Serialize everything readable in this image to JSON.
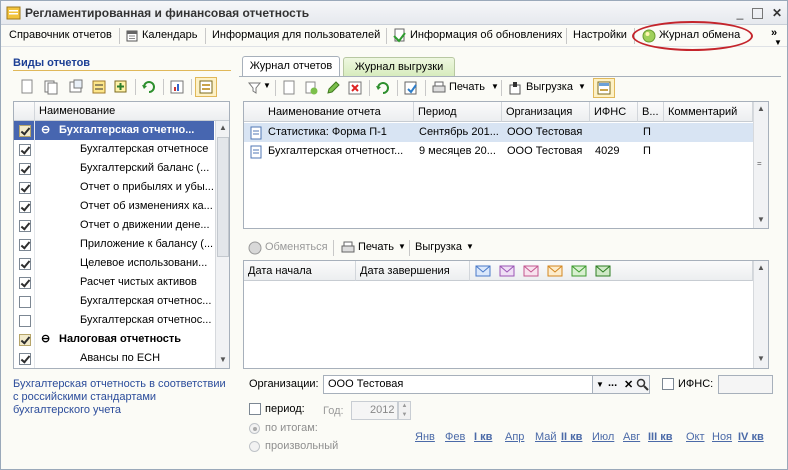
{
  "window": {
    "title": "Регламентированная и финансовая отчетность"
  },
  "menu": {
    "items": [
      "Справочник отчетов",
      "Календарь",
      "Информация для пользователей",
      "Информация об обновлениях",
      "Настройки",
      "Журнал обмена"
    ],
    "overflow": "»"
  },
  "left": {
    "title": "Виды отчетов",
    "tree_header": "Наименование",
    "rows": [
      {
        "label": "Бухгалтерская отчетно...",
        "checked": true,
        "group": true
      },
      {
        "label": "Бухгалтерская отчетносе",
        "checked": true
      },
      {
        "label": "Бухгалтерский баланс (...",
        "checked": true
      },
      {
        "label": "Отчет о прибылях и убы...",
        "checked": true
      },
      {
        "label": "Отчет об изменениях ка...",
        "checked": true
      },
      {
        "label": "Отчет о движении дене...",
        "checked": true
      },
      {
        "label": "Приложение к балансу (...",
        "checked": true
      },
      {
        "label": "Целевое использовани...",
        "checked": true
      },
      {
        "label": "Расчет чистых активов",
        "checked": true
      },
      {
        "label": "Бухгалтерская отчетнос...",
        "checked": false
      },
      {
        "label": "Бухгалтерская отчетнос...",
        "checked": false
      },
      {
        "label": "Налоговая отчетность",
        "checked": true,
        "group": true
      },
      {
        "label": "Авансы по ЕСН",
        "checked": true
      }
    ],
    "description": "Бухгалтерская отчетность в соответствии с российскими стандартами бухгалтерского учета"
  },
  "tabs": [
    "Журнал отчетов",
    "Журнал выгрузки"
  ],
  "toolbar1": {
    "print": "Печать",
    "export": "Выгрузка"
  },
  "reports_table": {
    "columns": [
      "Наименование отчета",
      "Период",
      "Организация",
      "ИФНС",
      "В...",
      "Комментарий"
    ],
    "rows": [
      [
        "Статистика: Форма П-1",
        "Сентябрь 201...",
        "ООО Тестовая",
        "",
        "П",
        ""
      ],
      [
        "Бухгалтерская отчетност...",
        "9 месяцев 20...",
        "ООО Тестовая",
        "4029",
        "П",
        ""
      ]
    ]
  },
  "toolbar2": {
    "exchange": "Обменяться",
    "print": "Печать",
    "export": "Выгрузка"
  },
  "exchange_table": {
    "columns": [
      "Дата начала",
      "Дата завершения"
    ]
  },
  "filter": {
    "org_label": "Организации:",
    "org_value": "ООО Тестовая",
    "ifns_label": "ИФНС:",
    "period_label": "период:",
    "year_label": "Год:",
    "year_value": "2012",
    "radio1": "по итогам:",
    "radio2": "произвольный",
    "months": [
      "Янв",
      "Фев",
      "I кв",
      "Апр",
      "Май",
      "II кв",
      "Июл",
      "Авг",
      "III кв",
      "Окт",
      "Ноя",
      "IV кв"
    ]
  },
  "colors": {
    "highlight": "#c4242b",
    "selection": "#d8e4f3",
    "link": "#4b6aa8",
    "title_blue": "#1c3f95"
  }
}
